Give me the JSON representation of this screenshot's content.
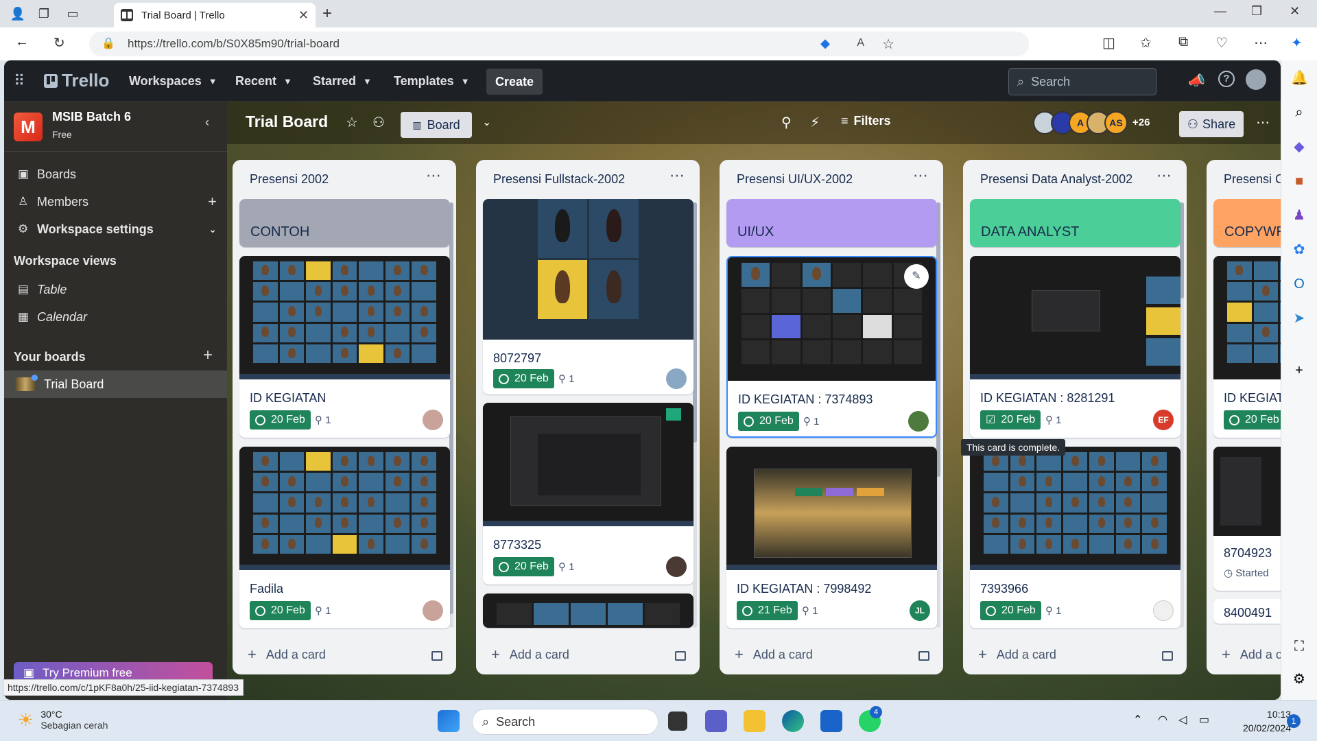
{
  "browser": {
    "tab_title": "Trial Board | Trello",
    "url": "https://trello.com/b/S0X85m90/trial-board",
    "status_url": "https://trello.com/c/1pKF8a0h/25-iid-kegiatan-7374893"
  },
  "header": {
    "logo": "Trello",
    "nav": [
      "Workspaces",
      "Recent",
      "Starred",
      "Templates"
    ],
    "create_label": "Create",
    "search_placeholder": "Search"
  },
  "sidebar": {
    "workspace_initial": "M",
    "workspace_name": "MSIB Batch 6",
    "workspace_plan": "Free",
    "items": [
      {
        "label": "Boards",
        "icon": "trello-icon"
      },
      {
        "label": "Members",
        "icon": "person-icon"
      },
      {
        "label": "Workspace settings",
        "icon": "gear-icon"
      }
    ],
    "views_heading": "Workspace views",
    "views": [
      {
        "label": "Table",
        "icon": "table-icon"
      },
      {
        "label": "Calendar",
        "icon": "calendar-icon"
      }
    ],
    "boards_heading": "Your boards",
    "boards": [
      {
        "label": "Trial Board"
      }
    ],
    "premium_label": "Try Premium free"
  },
  "board": {
    "title": "Trial Board",
    "view_label": "Board",
    "filters_label": "Filters",
    "member_overflow": "+26",
    "avatars": [
      "A",
      "AS"
    ],
    "share_label": "Share",
    "tooltip": "This card is complete.",
    "add_card_label": "Add a card"
  },
  "lists": [
    {
      "title": "Presensi 2002",
      "cover_card": {
        "label": "CONTOH",
        "color": "#a3a7b3"
      },
      "cards": [
        {
          "title": "ID KEGIATAN",
          "due": "20 Feb",
          "attachments": "1"
        },
        {
          "title": "Fadila",
          "due": "20 Feb",
          "attachments": "1"
        }
      ]
    },
    {
      "title": "Presensi Fullstack-2002",
      "cards": [
        {
          "title": "8072797",
          "due": "20 Feb",
          "attachments": "1"
        },
        {
          "title": "8773325",
          "due": "20 Feb",
          "attachments": "1"
        }
      ]
    },
    {
      "title": "Presensi UI/UX-2002",
      "cover_card": {
        "label": "UI/UX",
        "color": "#b49bf2"
      },
      "cards": [
        {
          "title": "ID KEGIATAN : 7374893",
          "due": "20 Feb",
          "attachments": "1"
        },
        {
          "title": "ID KEGIATAN : 7998492",
          "due": "21 Feb",
          "attachments": "1",
          "member": "JL"
        }
      ]
    },
    {
      "title": "Presensi Data Analyst-2002",
      "cover_card": {
        "label": "DATA ANALYST",
        "color": "#4bce97"
      },
      "cards": [
        {
          "title": "ID KEGIATAN : 8281291",
          "due": "20 Feb",
          "attachments": "1",
          "member": "EF"
        },
        {
          "title": "7393966",
          "due": "20 Feb",
          "attachments": "1"
        }
      ]
    },
    {
      "title": "Presensi C",
      "cover_card": {
        "label": "COPYWR",
        "color": "#fea362"
      },
      "cards": [
        {
          "title": "ID KEGIAT",
          "due": "20 Feb"
        },
        {
          "title": "8704923",
          "status": "Started"
        },
        {
          "title": "8400491"
        }
      ]
    }
  ],
  "taskbar": {
    "temp": "30°C",
    "condition": "Sebagian cerah",
    "search": "Search",
    "whatsapp_badge": "4",
    "time": "10:13",
    "date": "20/02/2024",
    "notif_count": "1"
  },
  "colors": {
    "due_green": "#1f845a",
    "header_bg": "#1d2125",
    "accent_blue": "#0c66e4"
  }
}
